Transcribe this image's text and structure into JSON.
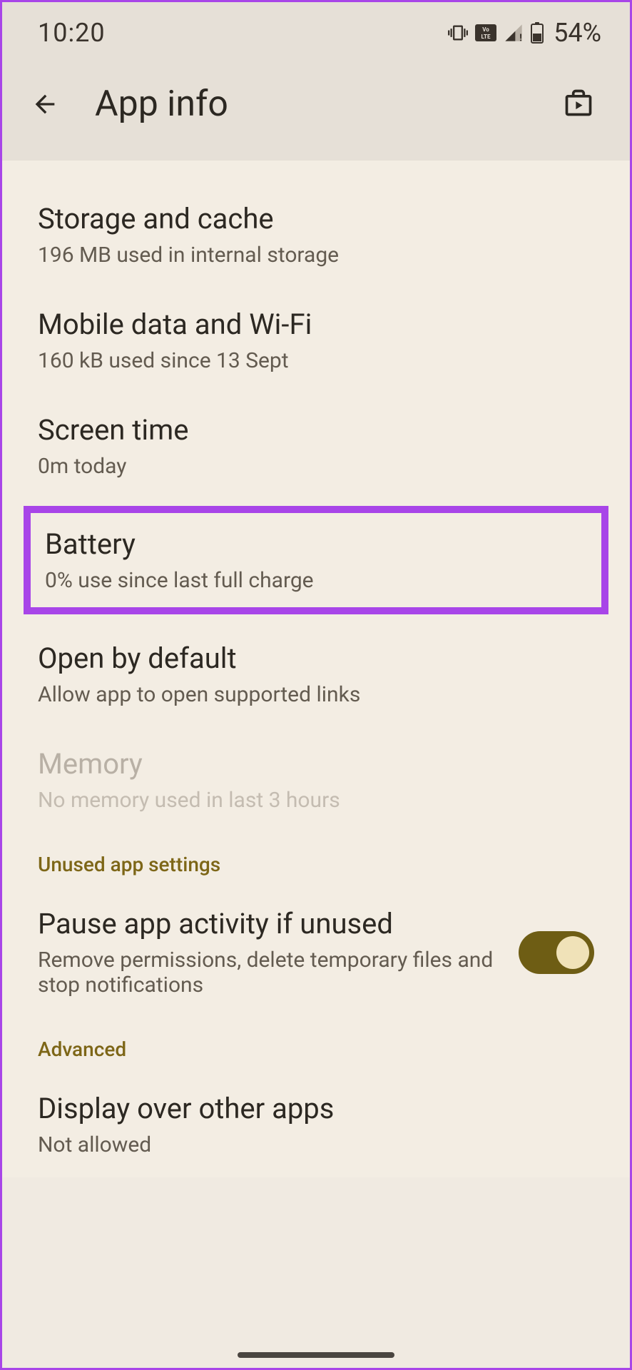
{
  "statusBar": {
    "time": "10:20",
    "batteryPercent": "54%"
  },
  "header": {
    "title": "App info"
  },
  "settings": {
    "storage": {
      "title": "Storage and cache",
      "subtitle": "196 MB used in internal storage"
    },
    "mobileData": {
      "title": "Mobile data and Wi-Fi",
      "subtitle": "160 kB used since 13 Sept"
    },
    "screenTime": {
      "title": "Screen time",
      "subtitle": "0m today"
    },
    "battery": {
      "title": "Battery",
      "subtitle": "0% use since last full charge"
    },
    "openByDefault": {
      "title": "Open by default",
      "subtitle": "Allow app to open supported links"
    },
    "memory": {
      "title": "Memory",
      "subtitle": "No memory used in last 3 hours"
    },
    "unusedSection": {
      "header": "Unused app settings"
    },
    "pauseActivity": {
      "title": "Pause app activity if unused",
      "subtitle": "Remove permissions, delete temporary files and stop notifications"
    },
    "advancedSection": {
      "header": "Advanced"
    },
    "displayOverApps": {
      "title": "Display over other apps",
      "subtitle": "Not allowed"
    }
  }
}
